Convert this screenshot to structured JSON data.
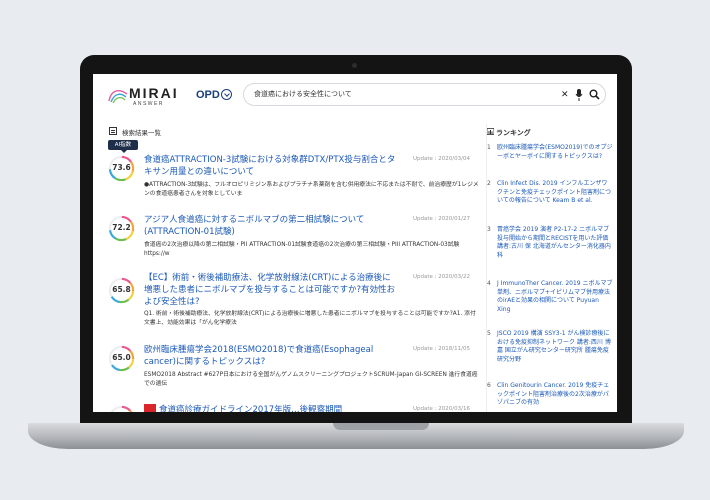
{
  "header": {
    "logo_text": "MIRAI",
    "logo_sub": "ANSWER",
    "category": "OPD",
    "search_value": "食道癌における安全性について"
  },
  "results": {
    "heading": "検索結果一覧",
    "ai_badge": "AI指数",
    "items": [
      {
        "score": "73.6",
        "score_fraction": 0.736,
        "title": "食道癌ATTRACTION-3試験における対象群DTX/PTX投与割合とタキサン用量との違いについて",
        "date": "Update : 2020/03/04",
        "snippet": "●ATTRACTION-3試験は、フルオロピリミジン系およびプラチナ系薬剤を含む併用療法に不応または不耐で、前治療歴が1レジメンの食道癌患者さんを対象としていま"
      },
      {
        "score": "72.2",
        "score_fraction": 0.722,
        "title": "アジア人食道癌に対するニボルマブの第二相試験について(ATTRACTION-01試験)",
        "date": "Update : 2020/01/27",
        "snippet": "食道癌の2次治療以降の第二相試験・PII ATTRACTION-01試験食道癌の2次治療の第三相試験・PIII ATTRACTION-03試験https://w"
      },
      {
        "score": "65.8",
        "score_fraction": 0.658,
        "title": "【EC】術前・術後補助療法、化学放射線法(CRT)による治療後に増悪した患者にニボルマブを投与することは可能ですか?有効性および安全性は?",
        "date": "Update : 2020/03/22",
        "snippet": "Q1. 術前・術後補助療法、化学放射線法(CRT)による治療後に増悪した患者にニボルマブを投与することは可能ですか?A1. 添付文書上、効能効果は「がん化学療法"
      },
      {
        "score": "65.0",
        "score_fraction": 0.65,
        "title": "欧州臨床腫瘍学会2018(ESMO2018)で食道癌(Esophageal cancer)に関するトピックスは?",
        "date": "Update : 2018/11/05",
        "snippet": "ESMO2018 Abstract #627P日本における全国がんゲノムスクリーニングプロジェクトSCRUM-Japan GI-SCREEN 進行食道癌での遺伝"
      },
      {
        "score": "",
        "score_fraction": 0.64,
        "title": "食道癌診療ガイドライン2017年版…後観察期間",
        "date": "Update : 2020/03/16",
        "snippet": ""
      }
    ]
  },
  "ranking": {
    "heading": "ランキング",
    "items": [
      {
        "num": "1",
        "text": "欧州臨床腫瘍学会(ESMO2019)でのオプジーボとヤーボイに関するトピックスは?"
      },
      {
        "num": "2",
        "text": "Clin Infect Dis. 2019 インフルエンザワクチンと免疫チェックポイント阻害剤についての報告について Keam B et al."
      },
      {
        "num": "3",
        "text": "胃癌学会 2019 演者 P2-17-2 ニボルマブ投与開始から期間とRECISTを用いた評価 講者:古川 保 北海道がんセンター消化器内科"
      },
      {
        "num": "4",
        "text": "J ImmunoTher Cancer. 2019 ニボルマブ単剤、ニボルマブ+イピリムマブ併用療法のirAEと効果の相関について Puyuan Xing"
      },
      {
        "num": "5",
        "text": "JSCO 2019 構演 SSY3-1 がん検診療後における免疫抑制ネットワーク 講者:西川 博嘉 国立がん研究センター研究所 腫瘍免疫研究分野"
      },
      {
        "num": "6",
        "text": "Clin Genitourin Cancer. 2019 免疫チェックポイント阻害剤治療後の2次治療がパゾパニブの有効"
      }
    ]
  }
}
